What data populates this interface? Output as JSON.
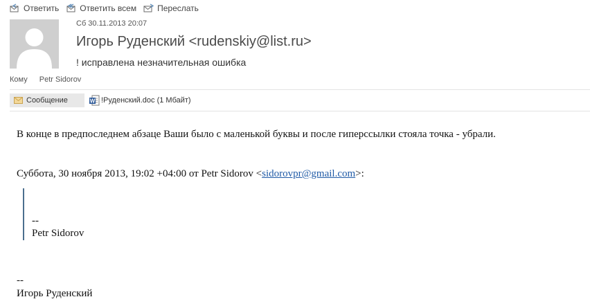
{
  "toolbar": {
    "reply_label": "Ответить",
    "reply_all_label": "Ответить всем",
    "forward_label": "Переслать"
  },
  "header": {
    "date": "Сб 30.11.2013 20:07",
    "sender": "Игорь Руденский <rudenskiy@list.ru>",
    "subject": "! исправлена незначительная ошибка",
    "to_label": "Кому",
    "to_value": "Petr Sidorov"
  },
  "attachments": {
    "message_tab": "Сообщение",
    "file": "!Руденский.doc (1 Мбайт)"
  },
  "body": {
    "line1": "В конце в предпоследнем абзаце Ваши было с маленькой буквы и после гиперссылки стояла точка - убрали.",
    "quote_header_prefix": "Суббота, 30 ноября 2013, 19:02 +04:00 от Petr Sidorov <",
    "quote_header_link": "sidorovpr@gmail.com",
    "quote_header_suffix": ">:",
    "quote_dashes": "--",
    "quote_name": "Petr Sidorov",
    "sig_dashes": "--",
    "sig_name": "Игорь Руденский"
  },
  "colors": {
    "link": "#1f5aa6",
    "quote_bar": "#4b6f8e",
    "message_tab_bg": "#e8e8e8"
  }
}
